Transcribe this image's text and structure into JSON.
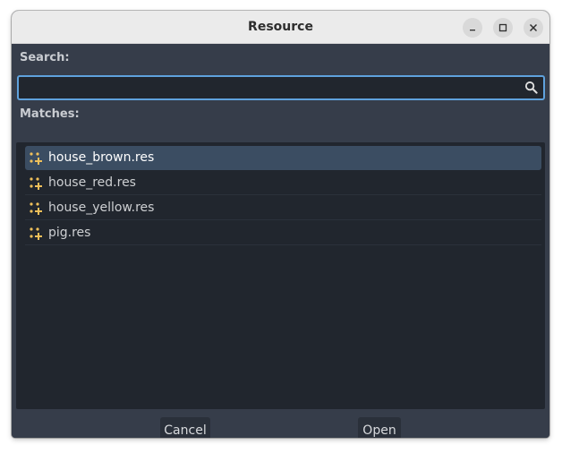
{
  "window": {
    "title": "Resource"
  },
  "search": {
    "label": "Search:",
    "value": "",
    "placeholder": ""
  },
  "matches": {
    "label": "Matches:",
    "items": [
      {
        "label": "house_brown.res",
        "selected": true,
        "icon": "resource-icon"
      },
      {
        "label": "house_red.res",
        "selected": false,
        "icon": "resource-icon"
      },
      {
        "label": "house_yellow.res",
        "selected": false,
        "icon": "resource-icon"
      },
      {
        "label": "pig.res",
        "selected": false,
        "icon": "resource-icon"
      }
    ]
  },
  "buttons": {
    "cancel": "Cancel",
    "open": "Open"
  },
  "colors": {
    "accent": "#5fa2dd",
    "resource_icon": "#f0c05a",
    "selected_row": "#3b4d62"
  }
}
